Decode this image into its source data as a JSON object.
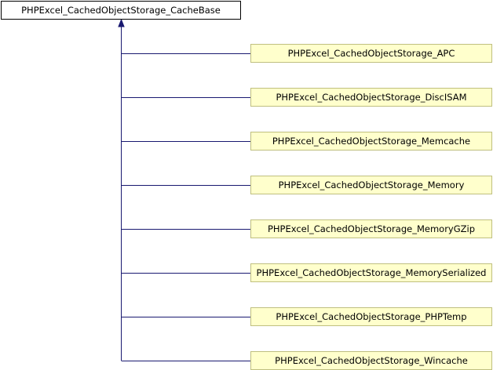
{
  "diagram": {
    "base": {
      "label": "PHPExcel_CachedObjectStorage_CacheBase"
    },
    "derived": [
      {
        "label": "PHPExcel_CachedObjectStorage_APC"
      },
      {
        "label": "PHPExcel_CachedObjectStorage_DiscISAM"
      },
      {
        "label": "PHPExcel_CachedObjectStorage_Memcache"
      },
      {
        "label": "PHPExcel_CachedObjectStorage_Memory"
      },
      {
        "label": "PHPExcel_CachedObjectStorage_MemoryGZip"
      },
      {
        "label": "PHPExcel_CachedObjectStorage_MemorySerialized"
      },
      {
        "label": "PHPExcel_CachedObjectStorage_PHPTemp"
      },
      {
        "label": "PHPExcel_CachedObjectStorage_Wincache"
      }
    ],
    "colors": {
      "edge": "#191970",
      "derived_fill": "#ffffcc",
      "derived_border": "#bfbf7f",
      "base_fill": "#ffffff",
      "base_border": "#000000"
    }
  }
}
